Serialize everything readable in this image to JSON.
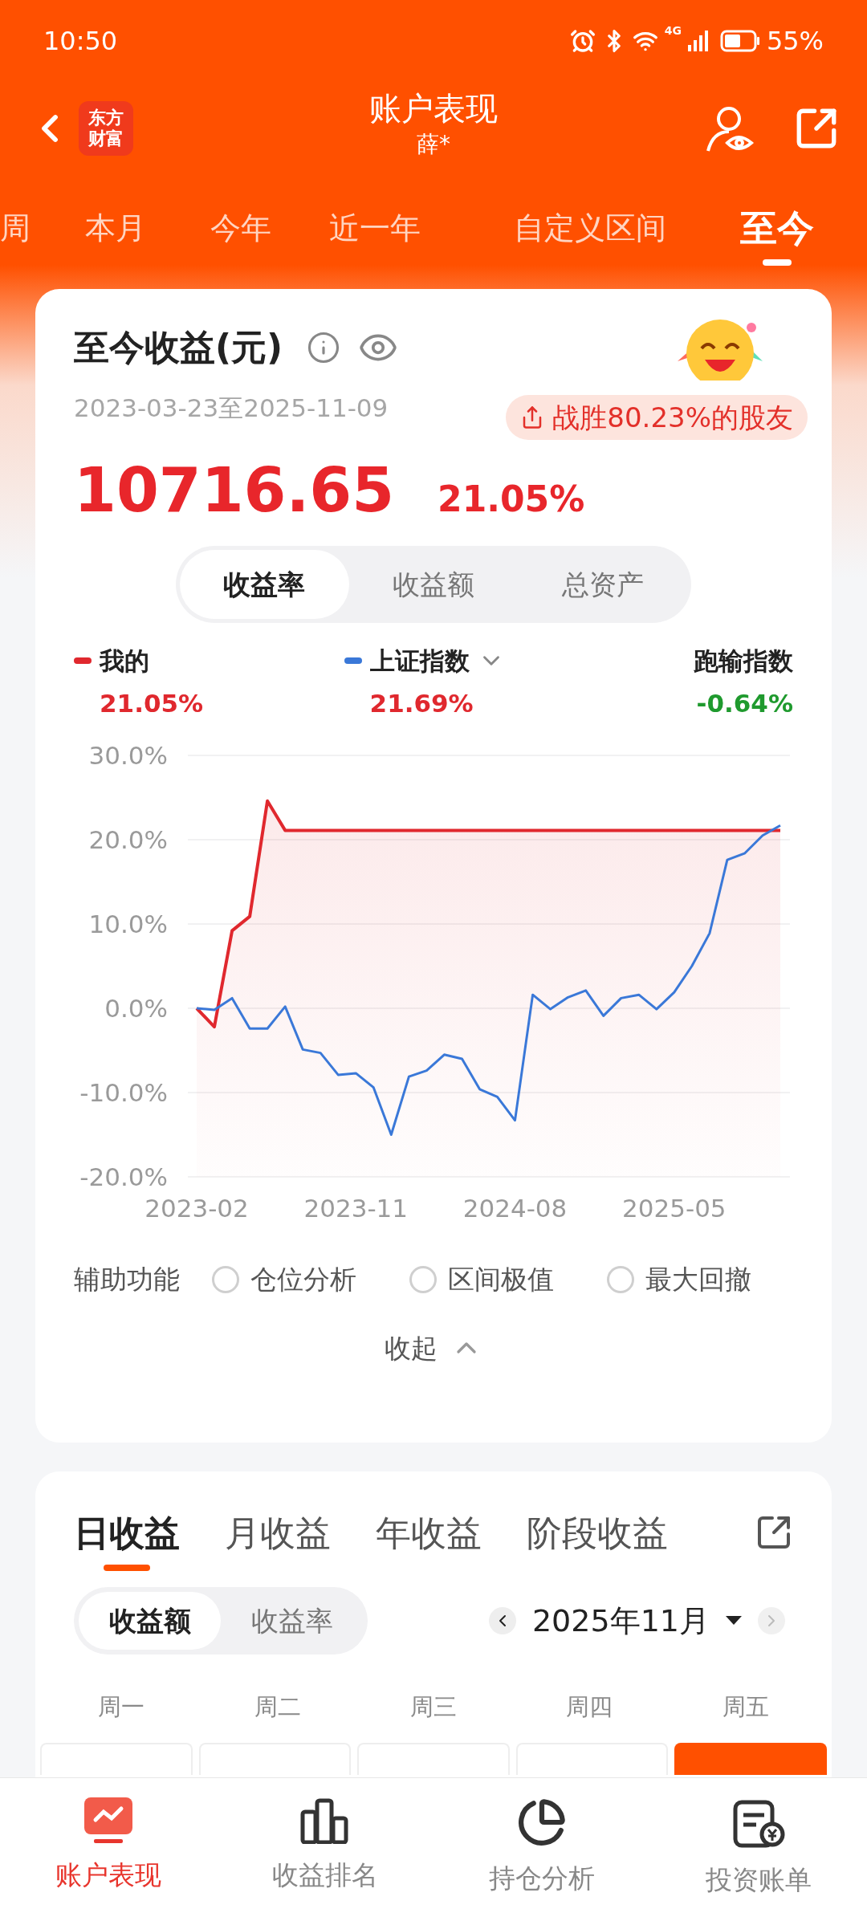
{
  "status_bar": {
    "time": "10:50",
    "network": "4G",
    "battery": "55%"
  },
  "header": {
    "logo_lines": [
      "东方",
      "财富"
    ],
    "title": "账户表现",
    "subtitle": "薛*"
  },
  "period_tabs": [
    {
      "label": "周",
      "selected": false
    },
    {
      "label": "本月",
      "selected": false
    },
    {
      "label": "今年",
      "selected": false
    },
    {
      "label": "近一年",
      "selected": false
    },
    {
      "label": "自定义区间",
      "selected": false
    },
    {
      "label": "至今",
      "selected": true
    }
  ],
  "summary": {
    "title": "至今收益(元)",
    "date_range": "2023-03-23至2025-11-09",
    "beat_badge": "战胜80.23%的股友",
    "amount": "10716.65",
    "rate": "21.05%"
  },
  "metric_tabs": [
    {
      "label": "收益率",
      "selected": true
    },
    {
      "label": "收益额",
      "selected": false
    },
    {
      "label": "总资产",
      "selected": false
    }
  ],
  "legend": [
    {
      "name": "我的",
      "value": "21.05%",
      "color": "#e0282e",
      "positive": true,
      "dropdown": false
    },
    {
      "name": "上证指数",
      "value": "21.69%",
      "color": "#3a78d8",
      "positive": true,
      "dropdown": true
    },
    {
      "name": "跑输指数",
      "value": "-0.64%",
      "positive": false,
      "dropdown": false
    }
  ],
  "chart_data": {
    "type": "line",
    "grid": true,
    "categories": [
      "2023-02",
      null,
      null,
      null,
      null,
      null,
      null,
      null,
      null,
      "2023-11",
      null,
      null,
      null,
      null,
      null,
      null,
      null,
      null,
      "2024-08",
      null,
      null,
      null,
      null,
      null,
      null,
      null,
      null,
      "2025-05",
      null,
      null,
      null,
      null,
      null,
      null
    ],
    "ylim": [
      -20,
      30
    ],
    "yticks": [
      {
        "value": 30,
        "label": "30.0%"
      },
      {
        "value": 20,
        "label": "20.0%"
      },
      {
        "value": 10,
        "label": "10.0%"
      },
      {
        "value": 0,
        "label": "0.0%"
      },
      {
        "value": -10,
        "label": "-10.0%"
      },
      {
        "value": -20,
        "label": "-20.0%"
      }
    ],
    "series": [
      {
        "color": "#e0282e",
        "values": [
          0,
          -2.2,
          9.2,
          10.9,
          24.6,
          21.1,
          21.1,
          21.1,
          21.1,
          21.1,
          21.1,
          21.1,
          21.1,
          21.1,
          21.1,
          21.1,
          21.1,
          21.1,
          21.1,
          21.1,
          21.1,
          21.1,
          21.1,
          21.1,
          21.1,
          21.1,
          21.1,
          21.1,
          21.1,
          21.1,
          21.1,
          21.1,
          21.1,
          21.1
        ]
      },
      {
        "color": "#3a78d8",
        "values": [
          0,
          -0.2,
          1.2,
          -2.4,
          -2.4,
          0.2,
          -4.9,
          -5.3,
          -7.9,
          -7.7,
          -9.4,
          -15,
          -8.1,
          -7.4,
          -5.5,
          -6,
          -9.6,
          -10.5,
          -13.3,
          1.6,
          -0.1,
          1.3,
          2.1,
          -0.9,
          1.2,
          1.6,
          -0.1,
          1.9,
          5,
          8.9,
          17.6,
          18.4,
          20.5,
          21.7
        ]
      }
    ]
  },
  "assist": {
    "label": "辅助功能",
    "options": [
      {
        "label": "仓位分析",
        "checked": false
      },
      {
        "label": "区间极值",
        "checked": false
      },
      {
        "label": "最大回撤",
        "checked": false
      }
    ]
  },
  "collapse": "收起",
  "income_tabs": [
    {
      "label": "日收益",
      "selected": true
    },
    {
      "label": "月收益",
      "selected": false
    },
    {
      "label": "年收益",
      "selected": false
    },
    {
      "label": "阶段收益",
      "selected": false
    }
  ],
  "mode_tabs": [
    {
      "label": "收益额",
      "selected": true
    },
    {
      "label": "收益率",
      "selected": false
    }
  ],
  "month": "2025年11月",
  "weekdays": [
    "周一",
    "周二",
    "周三",
    "周四",
    "周五"
  ],
  "calendar_cells": [
    {
      "selected": false
    },
    {
      "selected": false
    },
    {
      "selected": false
    },
    {
      "selected": false
    },
    {
      "selected": true
    }
  ],
  "bottom_nav": [
    {
      "label": "账户表现",
      "selected": true
    },
    {
      "label": "收益排名",
      "selected": false
    },
    {
      "label": "持仓分析",
      "selected": false
    },
    {
      "label": "投资账单",
      "selected": false
    }
  ]
}
